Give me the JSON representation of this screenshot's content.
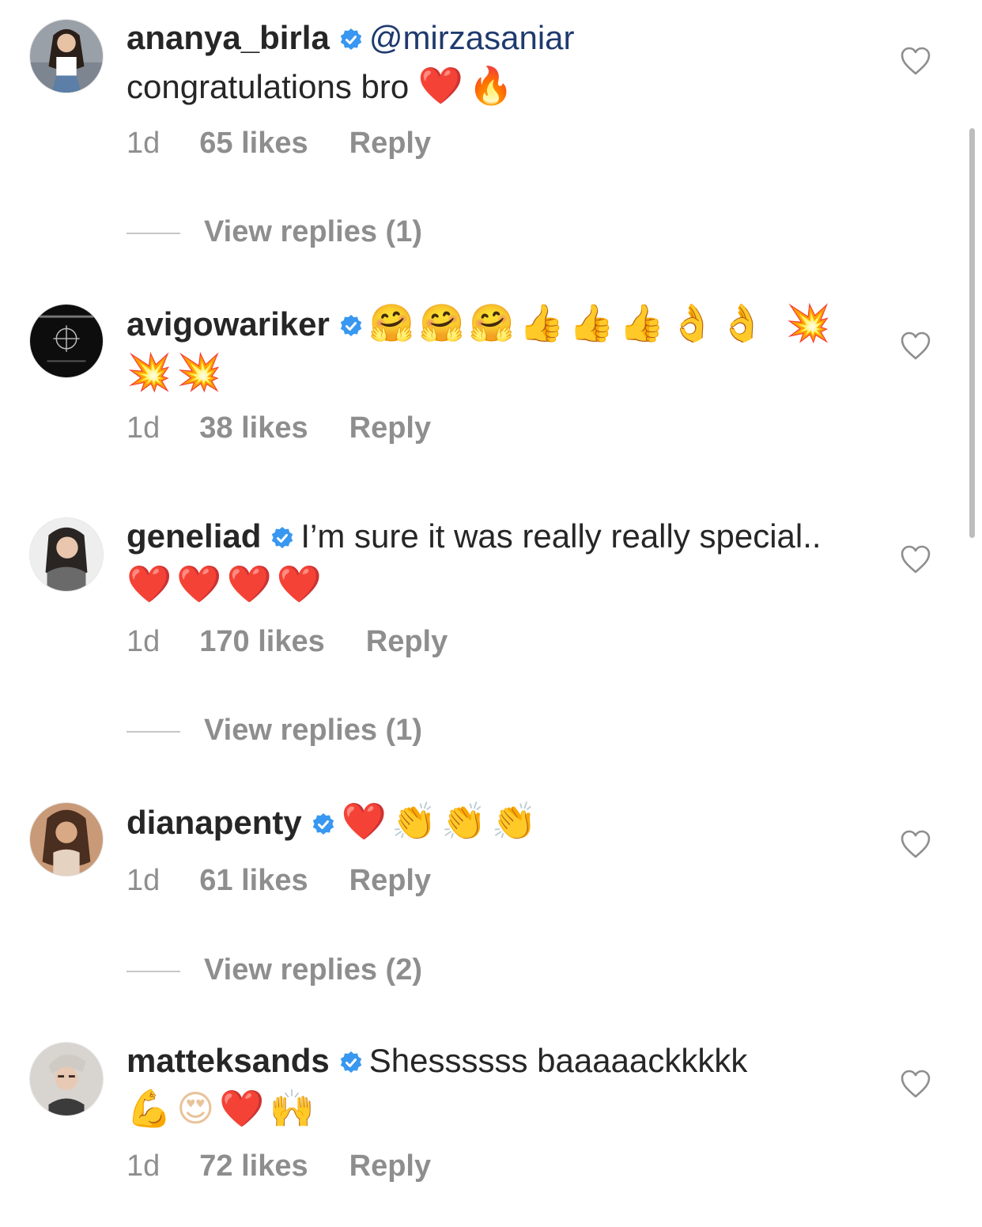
{
  "comments": [
    {
      "username": "ananya_birla",
      "mention": "@mirzasaniar",
      "text": "congratulations bro",
      "emojis": "❤️🔥",
      "time": "1d",
      "likes": "65 likes",
      "reply": "Reply",
      "view_replies": "View replies (1)"
    },
    {
      "username": "avigowariker",
      "mention": "",
      "text": "",
      "emojis": "🤗🤗🤗👍👍👍👌👌 💥💥💥",
      "time": "1d",
      "likes": "38 likes",
      "reply": "Reply",
      "view_replies": ""
    },
    {
      "username": "geneliad",
      "mention": "",
      "text": "I’m sure it was really really special..",
      "emojis": "❤️❤️❤️❤️",
      "time": "1d",
      "likes": "170 likes",
      "reply": "Reply",
      "view_replies": "View replies (1)"
    },
    {
      "username": "dianapenty",
      "mention": "",
      "text": "",
      "emojis": "❤️👏👏👏",
      "time": "1d",
      "likes": "61 likes",
      "reply": "Reply",
      "view_replies": "View replies (2)"
    },
    {
      "username": "matteksands",
      "mention": "",
      "text": "Shessssss baaaaackkkkk",
      "emojis": "💪😍❤️🙌",
      "time": "1d",
      "likes": "72 likes",
      "reply": "Reply",
      "view_replies": ""
    }
  ],
  "icons": {
    "verified": "verified-badge-icon",
    "like": "heart-outline-icon"
  },
  "colors": {
    "verified_blue": "#3897f0",
    "meta_gray": "#8e8e8e",
    "mention_blue": "#1f3a6e",
    "text": "#262626"
  }
}
